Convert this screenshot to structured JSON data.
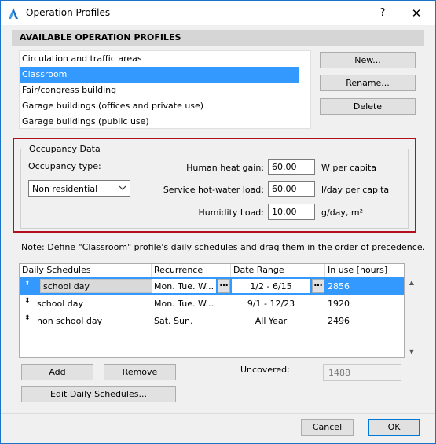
{
  "window": {
    "title": "Operation Profiles",
    "help_label": "?",
    "close_label": "✕"
  },
  "profiles": {
    "header": "AVAILABLE OPERATION PROFILES",
    "items": [
      {
        "label": "Circulation and traffic areas"
      },
      {
        "label": "Classroom"
      },
      {
        "label": "Fair/congress building"
      },
      {
        "label": "Garage buildings (offices and private use)"
      },
      {
        "label": "Garage buildings (public use)"
      }
    ],
    "selected_index": 1,
    "buttons": {
      "new": "New...",
      "rename": "Rename...",
      "delete": "Delete"
    }
  },
  "occupancy": {
    "legend": "Occupancy Data",
    "type_label": "Occupancy type:",
    "type_value": "Non residential",
    "heat_gain": {
      "label": "Human heat gain:",
      "value": "60.00",
      "unit": "W per capita"
    },
    "hot_water": {
      "label": "Service hot-water load:",
      "value": "60.00",
      "unit": "l/day per capita"
    },
    "humidity": {
      "label": "Humidity Load:",
      "value": "10.00",
      "unit": "g/day, m²"
    }
  },
  "note": "Note: Define \"Classroom\" profile's daily schedules and drag them in the order of precedence.",
  "schedules": {
    "headers": {
      "daily": "Daily Schedules",
      "recurrence": "Recurrence",
      "date_range": "Date Range",
      "in_use": "In use [hours]"
    },
    "rows": [
      {
        "name": "school day",
        "recurrence": "Mon. Tue. W...",
        "date_range": "1/2 - 6/15",
        "in_use": "2856"
      },
      {
        "name": "school day",
        "recurrence": "Mon. Tue. W...",
        "date_range": "9/1 - 12/23",
        "in_use": "1920"
      },
      {
        "name": "non school day",
        "recurrence": "Sat. Sun.",
        "date_range": "All Year",
        "in_use": "2496"
      }
    ],
    "selected_index": 0,
    "buttons": {
      "add": "Add",
      "remove": "Remove",
      "edit": "Edit Daily Schedules..."
    },
    "uncovered": {
      "label": "Uncovered:",
      "value": "1488"
    }
  },
  "footer": {
    "cancel": "Cancel",
    "ok": "OK"
  },
  "colors": {
    "accent": "#3399ff",
    "highlight_border": "#b20f1e",
    "window_border": "#1a73c9"
  }
}
